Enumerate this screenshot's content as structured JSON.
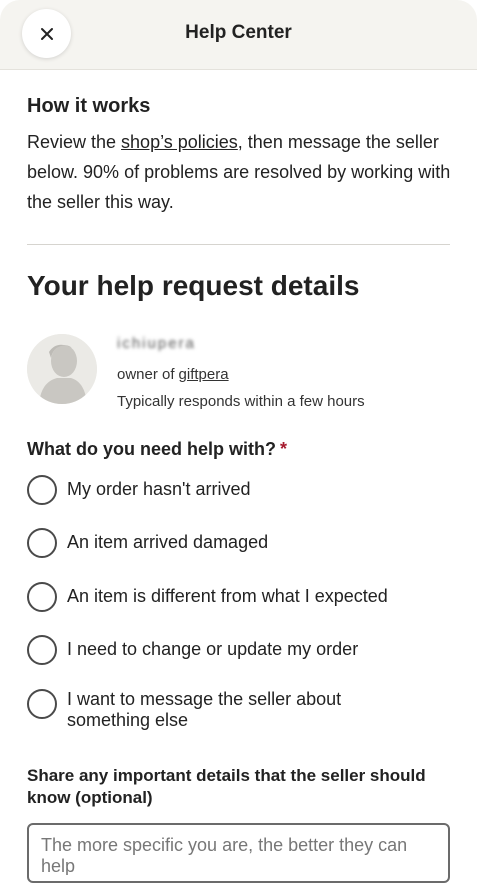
{
  "header": {
    "title": "Help Center",
    "close_icon": "close-icon"
  },
  "how_it_works": {
    "title": "How it works",
    "text_before": "Review the ",
    "policies_link": "shop’s policies",
    "text_after": ", then message the seller below. 90% of problems are resolved by working with the seller this way."
  },
  "request": {
    "title": "Your help request details"
  },
  "seller": {
    "name": "ichiupera",
    "owner_prefix": "owner of",
    "shop_name": "giftpera",
    "response_time": "Typically responds within a few hours"
  },
  "question": {
    "label": "What do you need help with?",
    "required_mark": "*",
    "options": [
      {
        "label": "My order hasn't arrived"
      },
      {
        "label": "An item arrived damaged"
      },
      {
        "label": "An item is different from what I expected"
      },
      {
        "label": "I need to change or update my order"
      },
      {
        "label": "I want to message the seller about something else"
      }
    ]
  },
  "details": {
    "label": "Share any important details that the seller should know (optional)",
    "placeholder": "The more specific you are, the better they can help",
    "value": ""
  },
  "colors": {
    "header_bg": "#f5f4f0",
    "required": "#a61a2e",
    "text": "#222222"
  }
}
